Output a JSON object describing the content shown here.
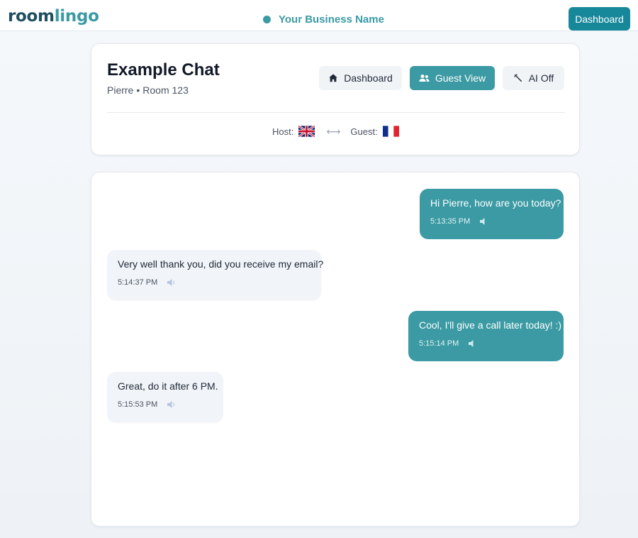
{
  "topbar": {
    "logo_main": "room",
    "logo_accent": "lingo",
    "business_name": "Your Business Name",
    "dashboard_label": "Dashboard"
  },
  "header": {
    "title": "Example Chat",
    "guest_name": "Pierre",
    "separator": "•",
    "room": "Room 123",
    "buttons": {
      "dashboard": "Dashboard",
      "guest_view": "Guest View",
      "ai_toggle": "AI Off"
    },
    "host_label": "Host:",
    "guest_label": "Guest:",
    "host_flag_icon": "uk-flag-icon",
    "guest_flag_icon": "france-flag-icon"
  },
  "messages": [
    {
      "direction": "out",
      "text": "Hi Pierre, how are you today?",
      "time": "5:13:35 PM"
    },
    {
      "direction": "in",
      "text": "Very well thank you, did you receive my email?",
      "time": "5:14:37 PM"
    },
    {
      "direction": "out",
      "text": "Cool, I'll give a call later today! :)",
      "time": "5:15:14 PM"
    },
    {
      "direction": "in",
      "text": "Great, do it after 6 PM.",
      "time": "5:15:53 PM"
    }
  ],
  "colors": {
    "accent": "#3b9aa3",
    "primary_button": "#17889a",
    "incoming_bubble": "#f1f4f8"
  }
}
